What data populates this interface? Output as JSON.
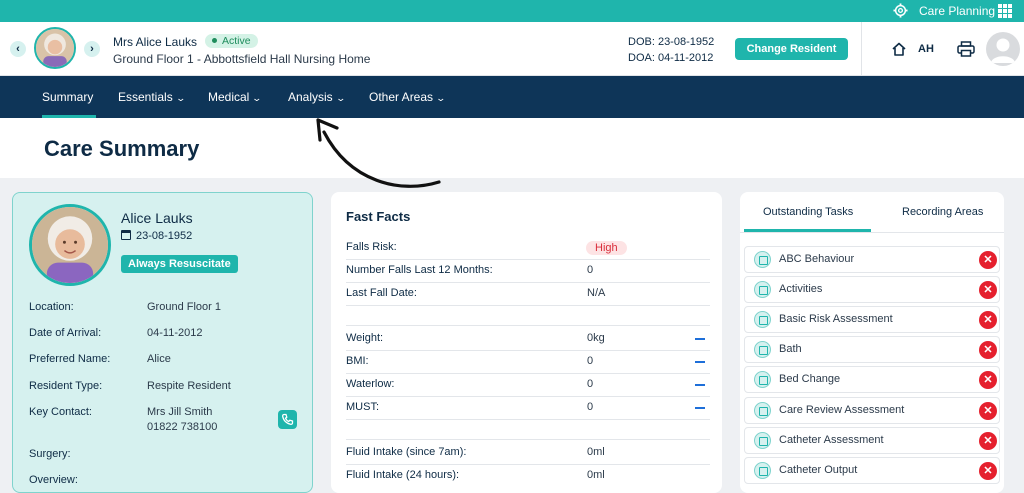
{
  "topbar": {
    "app_label": "Care Planning",
    "icons": [
      "gear-icon",
      "apps-grid-icon"
    ]
  },
  "resident": {
    "name": "Mrs Alice Lauks",
    "status": "Active",
    "location_line": "Ground Floor 1 - Abbottsfield Hall Nursing Home",
    "dob_label": "DOB: 23-08-1952",
    "doa_label": "DOA: 04-11-2012",
    "prev_icon": "‹",
    "next_icon": "›"
  },
  "header": {
    "change_button": "Change Resident",
    "user_initials": "AH",
    "icons": [
      "home-icon",
      "print-icon",
      "user-avatar-icon"
    ]
  },
  "nav": {
    "items": [
      {
        "label": "Summary",
        "active": true
      },
      {
        "label": "Essentials"
      },
      {
        "label": "Medical"
      },
      {
        "label": "Analysis"
      },
      {
        "label": "Other Areas"
      }
    ]
  },
  "page": {
    "title": "Care Summary"
  },
  "profile": {
    "name": "Alice Lauks",
    "dob": "23-08-1952",
    "badge": "Always Resuscitate",
    "rows": [
      {
        "label": "Location:",
        "value": "Ground Floor 1"
      },
      {
        "label": "Date of Arrival:",
        "value": "04-11-2012"
      },
      {
        "label": "Preferred Name:",
        "value": "Alice"
      },
      {
        "label": "Resident Type:",
        "value": "Respite Resident"
      },
      {
        "label": "Key Contact:",
        "value": "Mrs Jill Smith",
        "value2": "01822 738100"
      },
      {
        "label": "Surgery:",
        "value": ""
      },
      {
        "label": "Overview:",
        "value": ""
      }
    ]
  },
  "fast_facts": {
    "title": "Fast Facts",
    "rows": [
      {
        "label": "Falls Risk:",
        "value": "High"
      },
      {
        "label": "Number Falls Last 12 Months:",
        "value": "0"
      },
      {
        "label": "Last Fall Date:",
        "value": "N/A"
      },
      {
        "label": "Weight:",
        "value": "0kg"
      },
      {
        "label": "BMI:",
        "value": "0"
      },
      {
        "label": "Waterlow:",
        "value": "0"
      },
      {
        "label": "MUST:",
        "value": "0"
      },
      {
        "label": "Fluid Intake (since 7am):",
        "value": "0ml"
      },
      {
        "label": "Fluid Intake (24 hours):",
        "value": "0ml"
      }
    ]
  },
  "tasks": {
    "tabs": [
      "Outstanding Tasks",
      "Recording Areas"
    ],
    "items": [
      "ABC Behaviour",
      "Activities",
      "Basic Risk Assessment",
      "Bath",
      "Bed Change",
      "Care Review Assessment",
      "Catheter Assessment",
      "Catheter Output"
    ],
    "close_glyph": "✕"
  },
  "colors": {
    "teal": "#1fb5ac",
    "navy": "#0e3558",
    "danger": "#e5202e"
  }
}
